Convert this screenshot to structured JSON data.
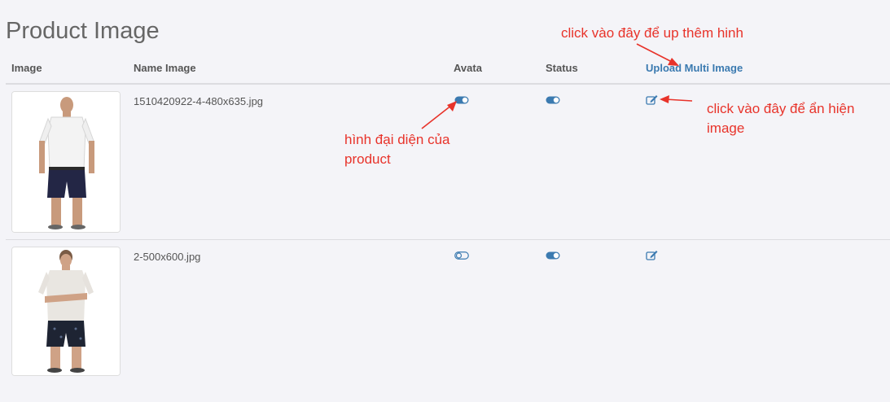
{
  "page": {
    "title": "Product Image"
  },
  "table": {
    "headers": {
      "image": "Image",
      "name": "Name Image",
      "avata": "Avata",
      "status": "Status",
      "upload": "Upload Multi Image"
    },
    "rows": [
      {
        "name": "1510420922-4-480x635.jpg",
        "avata_on": true,
        "status_on": true
      },
      {
        "name": "2-500x600.jpg",
        "avata_on": false,
        "status_on": true
      }
    ]
  },
  "annotations": {
    "upload_hint": "click vào đây để up thêm hinh",
    "avatar_hint_line1": "hình đại diện của",
    "avatar_hint_line2": "product",
    "edit_hint_line1": "click vào đây để ẩn hiện",
    "edit_hint_line2": "image"
  },
  "colors": {
    "toggle_on": "#3b7ab0",
    "link": "#3b7ab0",
    "annotation": "#e8332a"
  },
  "icons": {
    "avata": "toggle-icon",
    "status": "toggle-icon",
    "edit": "edit-icon"
  }
}
